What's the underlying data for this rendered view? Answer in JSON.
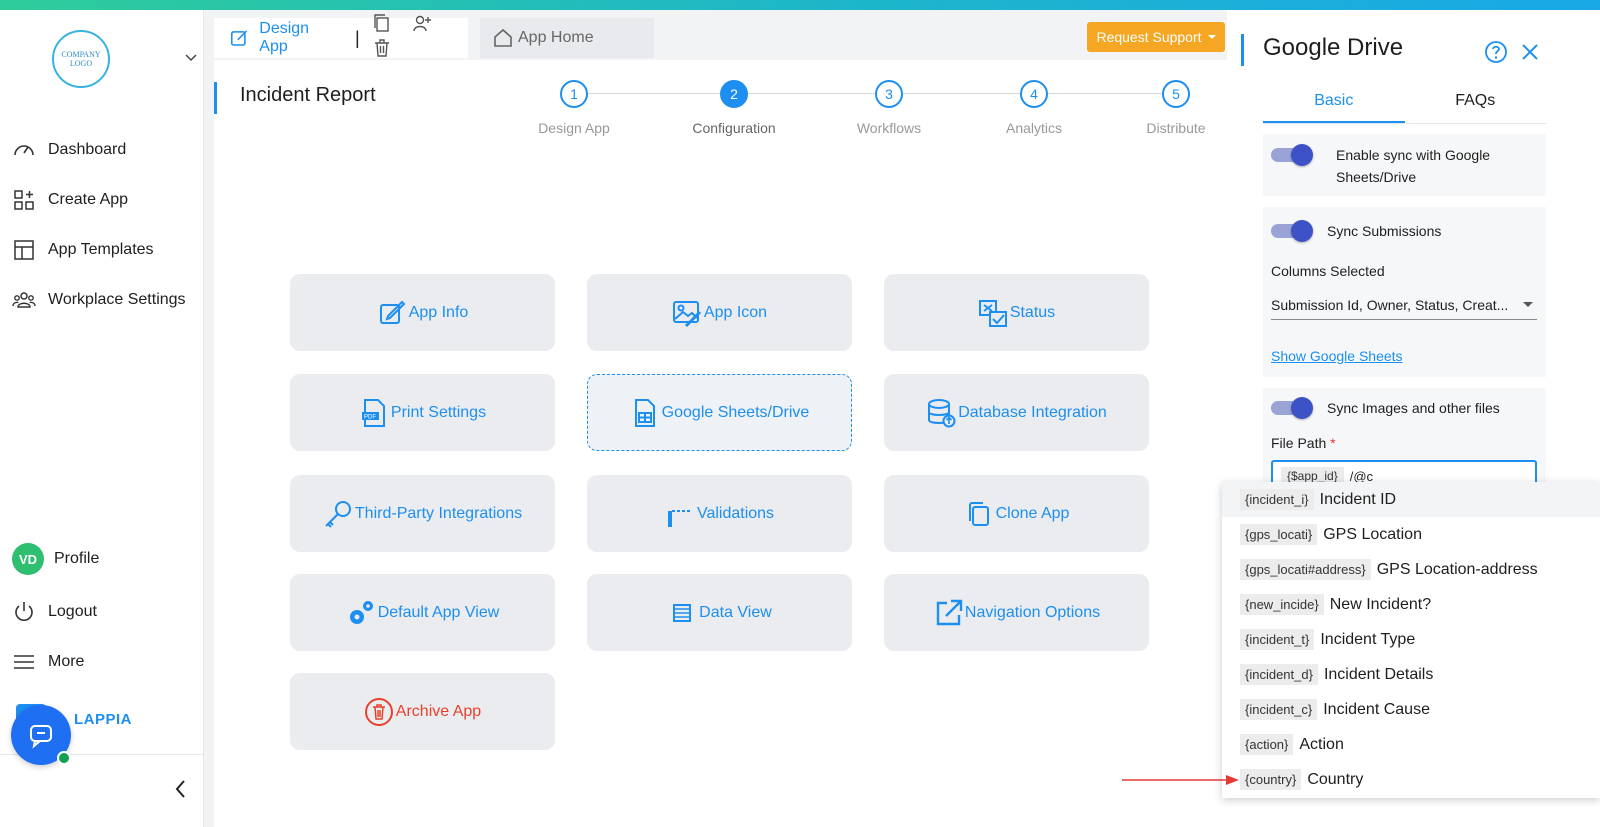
{
  "logo": {
    "text": "COMPANY LOGO"
  },
  "sidebar": {
    "items": [
      {
        "label": "Dashboard",
        "icon": "gauge-icon"
      },
      {
        "label": "Create App",
        "icon": "create-app-icon"
      },
      {
        "label": "App Templates",
        "icon": "templates-icon"
      },
      {
        "label": "Workplace Settings",
        "icon": "people-icon"
      }
    ],
    "profile": {
      "initials": "VD",
      "label": "Profile"
    },
    "logout": "Logout",
    "more": "More",
    "brand": "LAPPIA"
  },
  "tabs": {
    "design": "Design App",
    "home": "App Home",
    "separator": "|"
  },
  "request_support": "Request Support",
  "page": {
    "title": "Incident Report"
  },
  "steps": [
    {
      "num": "1",
      "label": "Design App"
    },
    {
      "num": "2",
      "label": "Configuration"
    },
    {
      "num": "3",
      "label": "Workflows"
    },
    {
      "num": "4",
      "label": "Analytics"
    },
    {
      "num": "5",
      "label": "Distribute"
    }
  ],
  "tiles": [
    {
      "label": "App Info",
      "icon": "edit-icon"
    },
    {
      "label": "App Icon",
      "icon": "image-edit-icon"
    },
    {
      "label": "Status",
      "icon": "status-icon"
    },
    {
      "label": "Print Settings",
      "icon": "pdf-icon"
    },
    {
      "label": "Google Sheets/Drive",
      "icon": "sheet-icon"
    },
    {
      "label": "Database Integration",
      "icon": "database-icon"
    },
    {
      "label": "Third-Party Integrations",
      "icon": "key-icon"
    },
    {
      "label": "Validations",
      "icon": "validation-icon"
    },
    {
      "label": "Clone App",
      "icon": "clone-icon"
    },
    {
      "label": "Default App View",
      "icon": "gears-icon"
    },
    {
      "label": "Data View",
      "icon": "list-icon"
    },
    {
      "label": "Navigation Options",
      "icon": "external-link-icon"
    },
    {
      "label": "Archive App",
      "icon": "trash-circle-icon"
    }
  ],
  "panel": {
    "title": "Google Drive",
    "tabs": [
      "Basic",
      "FAQs"
    ],
    "sync_drive_label": "Enable sync with Google Sheets/Drive",
    "sync_submissions_label": "Sync Submissions",
    "columns_label": "Columns Selected",
    "columns_value": "Submission Id, Owner, Status, Creat...",
    "show_sheets": "Show Google Sheets",
    "sync_images_label": "Sync Images and other files",
    "file_path_label": "File Path",
    "required_mark": "*",
    "file_path_chip": "{$app_id}",
    "file_path_text": "/@c"
  },
  "dropdown": [
    {
      "token": "{incident_i}",
      "label": "Incident ID"
    },
    {
      "token": "{gps_locati}",
      "label": "GPS Location"
    },
    {
      "token": "{gps_locati#address}",
      "label": "GPS Location-address"
    },
    {
      "token": "{new_incide}",
      "label": "New Incident?"
    },
    {
      "token": "{incident_t}",
      "label": "Incident Type"
    },
    {
      "token": "{incident_d}",
      "label": "Incident Details"
    },
    {
      "token": "{incident_c}",
      "label": "Incident Cause"
    },
    {
      "token": "{action}",
      "label": "Action"
    },
    {
      "token": "{country}",
      "label": "Country"
    }
  ],
  "colors": {
    "accent": "#1c8ff0",
    "support": "#f5a623",
    "danger": "#e8412c",
    "toggle": "#3d52c7",
    "annotation": "#e53935"
  }
}
